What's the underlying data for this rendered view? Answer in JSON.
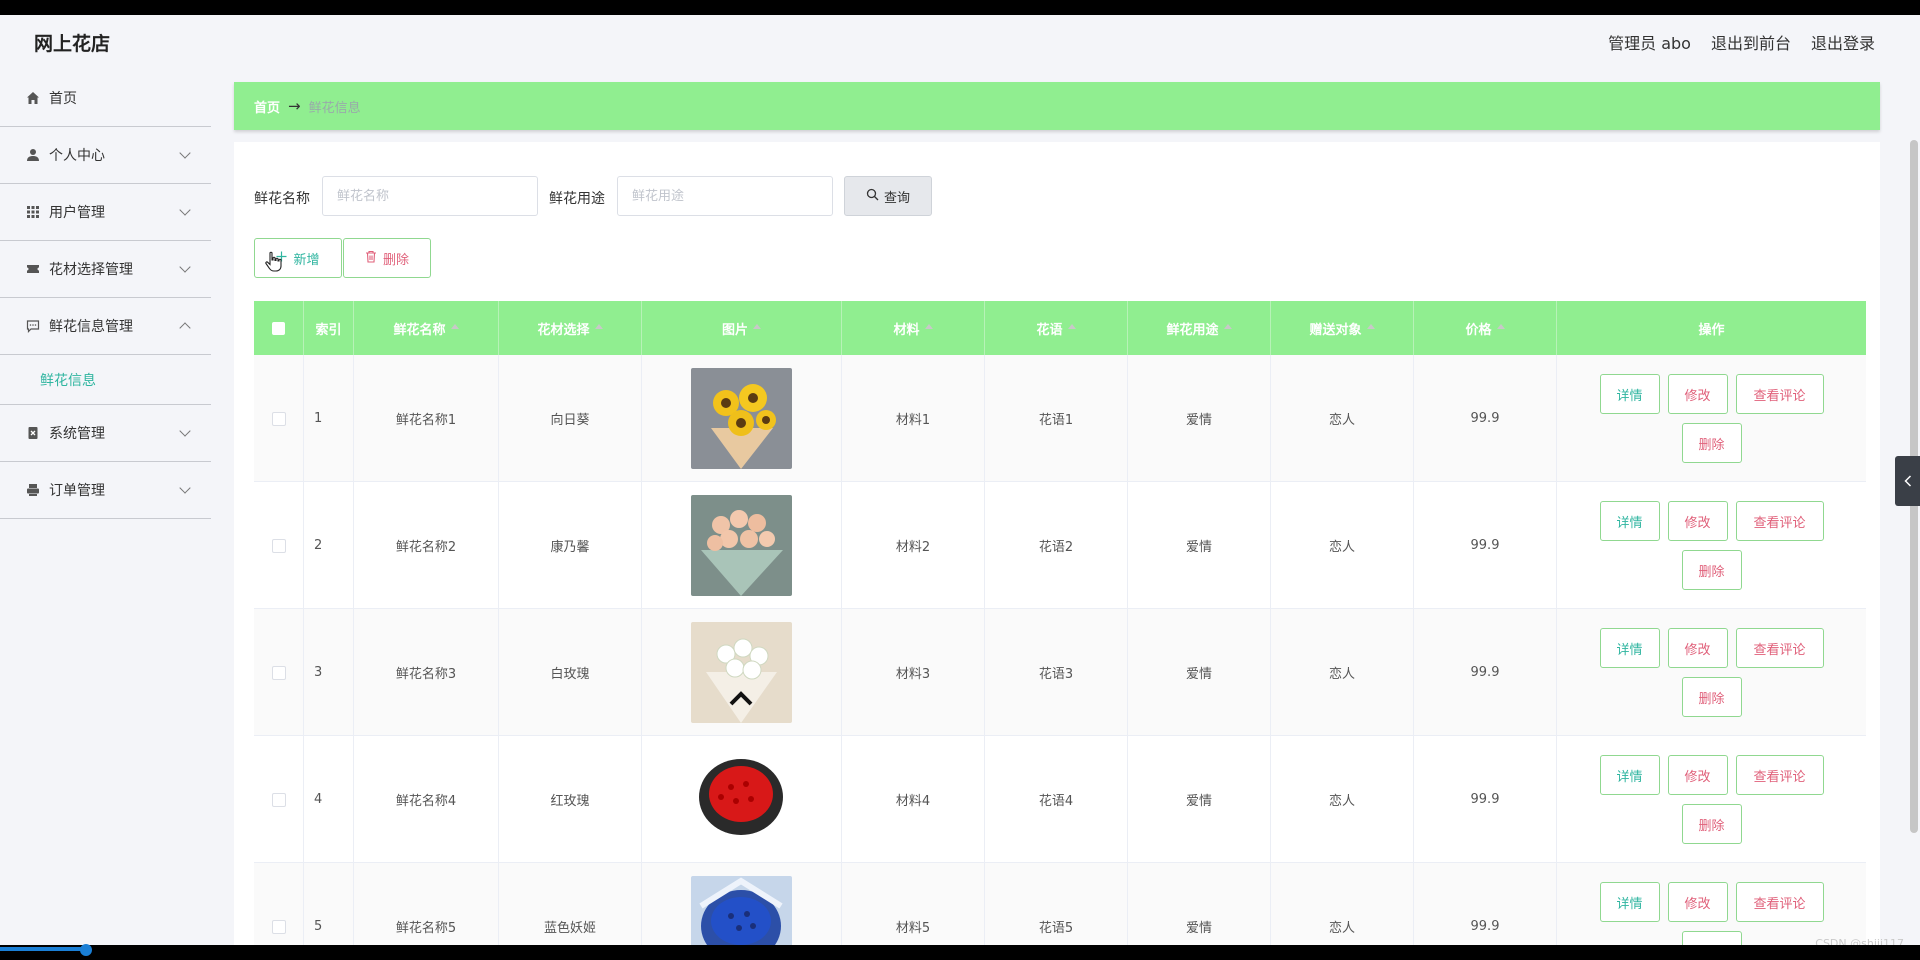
{
  "header": {
    "site_title": "网上花店",
    "admin_label": "管理员 abo",
    "front_link": "退出到前台",
    "logout_link": "退出登录"
  },
  "sidebar": {
    "items": [
      {
        "label": "首页",
        "icon": "home-icon"
      },
      {
        "label": "个人中心",
        "icon": "user-icon"
      },
      {
        "label": "用户管理",
        "icon": "grid-icon"
      },
      {
        "label": "花材选择管理",
        "icon": "ticket-icon"
      },
      {
        "label": "鲜花信息管理",
        "icon": "message-icon",
        "expanded": true
      },
      {
        "label": "系统管理",
        "icon": "delete-box-icon"
      },
      {
        "label": "订单管理",
        "icon": "printer-icon"
      }
    ],
    "submenu_active": "鲜花信息"
  },
  "breadcrumb": {
    "home": "首页",
    "arrow": "→",
    "current": "鲜花信息"
  },
  "search": {
    "name_label": "鲜花名称",
    "name_placeholder": "鲜花名称",
    "use_label": "鲜花用途",
    "use_placeholder": "鲜花用途",
    "query_button": "查询"
  },
  "actions": {
    "add": "新增",
    "delete": "删除"
  },
  "table": {
    "columns": [
      "索引",
      "鲜花名称",
      "花材选择",
      "图片",
      "材料",
      "花语",
      "鲜花用途",
      "赠送对象",
      "价格",
      "操作"
    ],
    "op_labels": {
      "detail": "详情",
      "edit": "修改",
      "review": "查看评论",
      "delete": "删除"
    },
    "rows": [
      {
        "index": "1",
        "name": "鲜花名称1",
        "category": "向日葵",
        "material": "材料1",
        "language": "花语1",
        "use": "爱情",
        "recipient": "恋人",
        "price": "99.9",
        "image": "sunflower-bouquet"
      },
      {
        "index": "2",
        "name": "鲜花名称2",
        "category": "康乃馨",
        "material": "材料2",
        "language": "花语2",
        "use": "爱情",
        "recipient": "恋人",
        "price": "99.9",
        "image": "carnation-bouquet"
      },
      {
        "index": "3",
        "name": "鲜花名称3",
        "category": "白玫瑰",
        "material": "材料3",
        "language": "花语3",
        "use": "爱情",
        "recipient": "恋人",
        "price": "99.9",
        "image": "white-rose-bouquet"
      },
      {
        "index": "4",
        "name": "鲜花名称4",
        "category": "红玫瑰",
        "material": "材料4",
        "language": "花语4",
        "use": "爱情",
        "recipient": "恋人",
        "price": "99.9",
        "image": "red-rose-bouquet"
      },
      {
        "index": "5",
        "name": "鲜花名称5",
        "category": "蓝色妖姬",
        "material": "材料5",
        "language": "花语5",
        "use": "爱情",
        "recipient": "恋人",
        "price": "99.9",
        "image": "blue-rose-bouquet"
      }
    ]
  },
  "watermark": "CSDN @shiji117",
  "colors": {
    "accent_green": "#90ee90",
    "teal_text": "#2fb5a0",
    "pink_text": "#e0607a"
  }
}
